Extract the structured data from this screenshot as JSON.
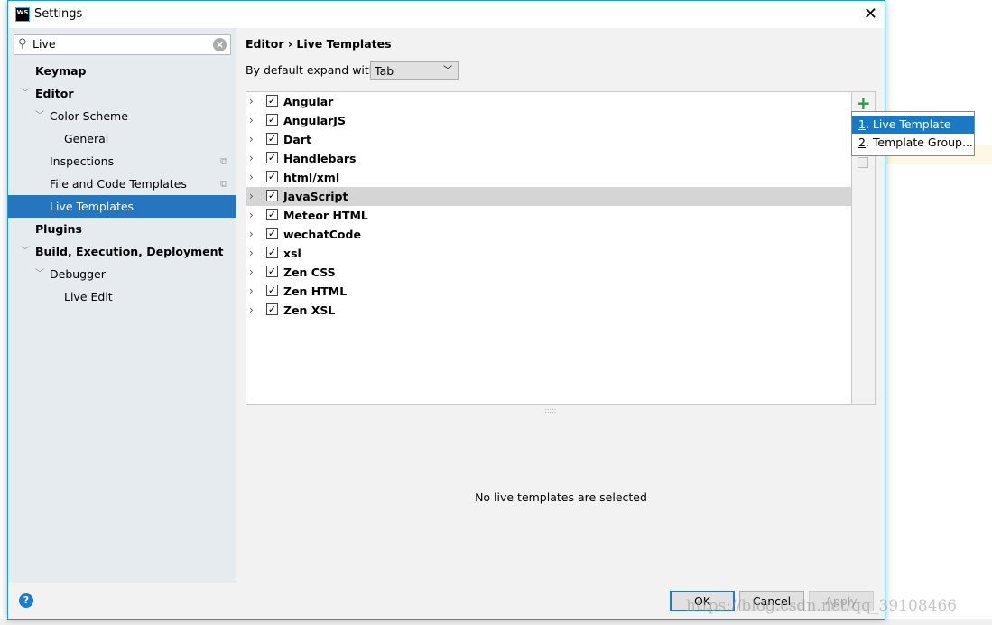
{
  "window": {
    "title": "Settings",
    "logo": "WS"
  },
  "search": {
    "value": "Live"
  },
  "tree": [
    {
      "label": "Keymap",
      "bold": true,
      "indent": 0,
      "chev": false
    },
    {
      "label": "Editor",
      "bold": true,
      "indent": 0,
      "chev": true
    },
    {
      "label": "Color Scheme",
      "bold": false,
      "indent": 1,
      "chev": true
    },
    {
      "label": "General",
      "bold": false,
      "indent": 2,
      "chev": false
    },
    {
      "label": "Inspections",
      "bold": false,
      "indent": 1,
      "chev": false,
      "copy": true
    },
    {
      "label": "File and Code Templates",
      "bold": false,
      "indent": 1,
      "chev": false,
      "copy": true
    },
    {
      "label": "Live Templates",
      "bold": false,
      "indent": 1,
      "chev": false,
      "selected": true
    },
    {
      "label": "Plugins",
      "bold": true,
      "indent": 0,
      "chev": false
    },
    {
      "label": "Build, Execution, Deployment",
      "bold": true,
      "indent": 0,
      "chev": true
    },
    {
      "label": "Debugger",
      "bold": false,
      "indent": 1,
      "chev": true
    },
    {
      "label": "Live Edit",
      "bold": false,
      "indent": 2,
      "chev": false
    }
  ],
  "breadcrumb": {
    "parent": "Editor",
    "sep": "›",
    "current": "Live Templates"
  },
  "expand": {
    "label": "By default expand with",
    "value": "Tab"
  },
  "templates": [
    "Angular",
    "AngularJS",
    "Dart",
    "Handlebars",
    "html/xml",
    "JavaScript",
    "Meteor HTML",
    "wechatCode",
    "xsl",
    "Zen CSS",
    "Zen HTML",
    "Zen XSL"
  ],
  "highlighted_template": "JavaScript",
  "empty_message": "No live templates are selected",
  "popup": {
    "items": [
      {
        "num": "1",
        "label": ". Live Template"
      },
      {
        "num": "2",
        "label": ". Template Group..."
      }
    ]
  },
  "buttons": {
    "ok": "OK",
    "cancel": "Cancel",
    "apply": "Apply",
    "help": "?"
  },
  "watermark": "https://blog.csdn.net/qq_39108466",
  "colors": {
    "selection": "#2675bf",
    "accent": "#1a7ccc",
    "add": "#2c9b3c"
  }
}
